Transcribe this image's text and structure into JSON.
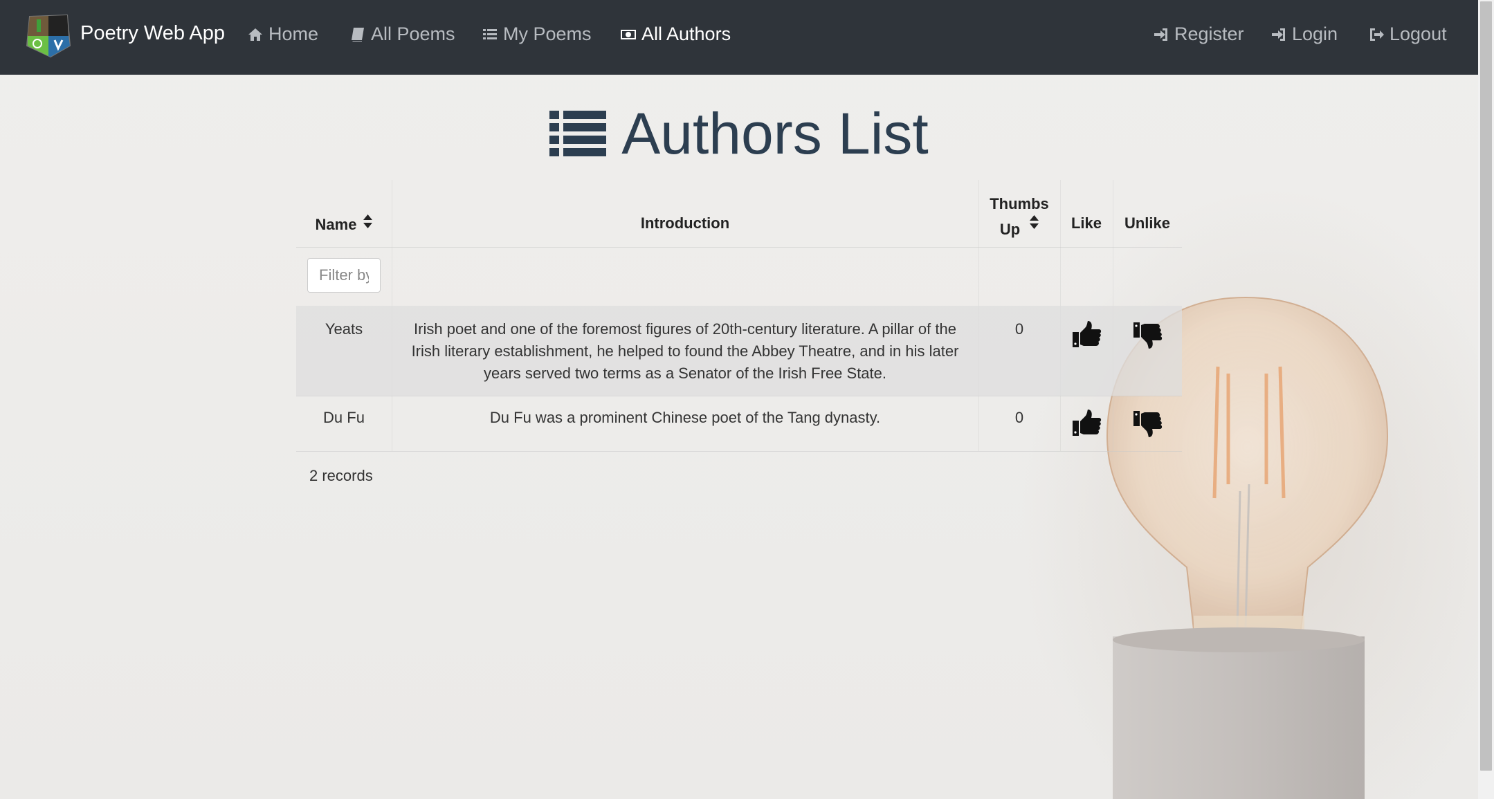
{
  "navbar": {
    "brand": "Poetry Web App",
    "items": [
      {
        "label": "Home",
        "icon": "home-icon"
      },
      {
        "label": "All Poems",
        "icon": "book-icon"
      },
      {
        "label": "My Poems",
        "icon": "list-icon"
      },
      {
        "label": "All Authors",
        "icon": "money-icon",
        "active": true
      }
    ],
    "right_items": [
      {
        "label": "Register",
        "icon": "sign-in-icon"
      },
      {
        "label": "Login",
        "icon": "sign-in-icon"
      },
      {
        "label": "Logout",
        "icon": "sign-out-icon"
      }
    ]
  },
  "page": {
    "title": "Authors List"
  },
  "table": {
    "headers": {
      "name": "Name",
      "introduction": "Introduction",
      "thumbs_up_line1": "Thumbs",
      "thumbs_up_line2": "Up",
      "like": "Like",
      "unlike": "Unlike"
    },
    "filter_placeholder": "Filter by",
    "rows": [
      {
        "name": "Yeats",
        "introduction": "Irish poet and one of the foremost figures of 20th-century literature. A pillar of the Irish literary establishment, he helped to found the Abbey Theatre, and in his later years served two terms as a Senator of the Irish Free State.",
        "thumbs_up": "0"
      },
      {
        "name": "Du Fu",
        "introduction": "Du Fu was a prominent Chinese poet of the Tang dynasty.",
        "thumbs_up": "0"
      }
    ],
    "record_count": "2 records"
  },
  "colors": {
    "navbar_bg": "#2f343a",
    "heading": "#2c3e50",
    "highlight_row": "#e3e3e2"
  }
}
